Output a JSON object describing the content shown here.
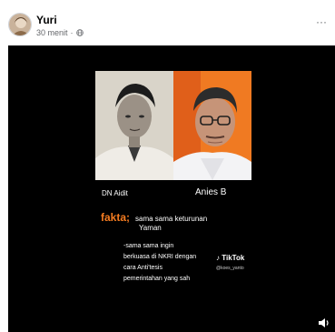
{
  "post": {
    "author": "Yuri",
    "time": "30 menit",
    "privacy_icon": "globe-icon",
    "more_label": "···"
  },
  "video": {
    "caption_left": "DN Aidit",
    "caption_right": "Anies B",
    "fakta_label": "fakta;",
    "fakta_line1": "sama sama keturunan",
    "fakta_line2": "Yaman",
    "desc_lines": [
      "-sama sama ingin",
      "berkuasa di NKRI dengan",
      "cara Anti'tesis",
      "pemerintahan yang sah"
    ],
    "watermark": "TikTok",
    "watermark_user": "@koes_yanto",
    "volume_icon": "volume-icon"
  },
  "colors": {
    "fakta": "#f47b20",
    "right_photo_bg": "#f07a22",
    "video_bg": "#000000"
  }
}
